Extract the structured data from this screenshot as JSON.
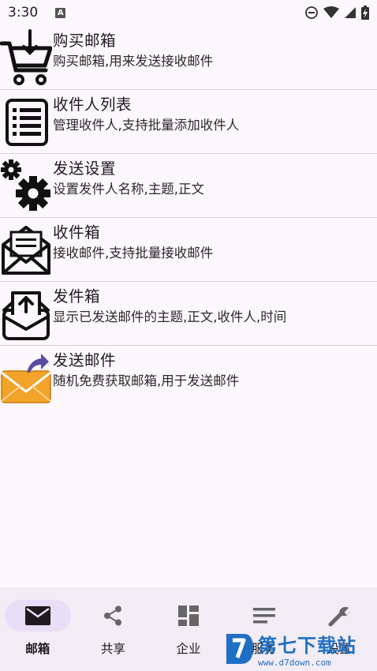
{
  "status_bar": {
    "time": "3:30",
    "badge": "A"
  },
  "list": {
    "items": [
      {
        "title": "购买邮箱",
        "desc": "购买邮箱,用来发送接收邮件",
        "icon": "shopping-cart-icon"
      },
      {
        "title": "收件人列表",
        "desc": "管理收件人,支持批量添加收件人",
        "icon": "list-icon"
      },
      {
        "title": "发送设置",
        "desc": "设置发件人名称,主题,正文",
        "icon": "gears-icon"
      },
      {
        "title": "收件箱",
        "desc": "接收邮件,支持批量接收邮件",
        "icon": "open-envelope-icon"
      },
      {
        "title": "发件箱",
        "desc": "显示已发送邮件的主题,正文,收件人,时间",
        "icon": "outbox-icon"
      },
      {
        "title": "发送邮件",
        "desc": "随机免费获取邮箱,用于发送邮件",
        "icon": "send-mail-icon"
      }
    ]
  },
  "bottom_nav": {
    "items": [
      {
        "label": "邮箱",
        "icon": "mail-icon",
        "active": true
      },
      {
        "label": "共享",
        "icon": "share-icon",
        "active": false
      },
      {
        "label": "企业",
        "icon": "dashboard-icon",
        "active": false
      },
      {
        "label": "服务",
        "icon": "lines-icon",
        "active": false
      },
      {
        "label": "设置",
        "icon": "wrench-icon",
        "active": false
      }
    ]
  },
  "watermark": {
    "name": "第七下载站",
    "url": "www.d7down.com"
  },
  "colors": {
    "background": "#fcf7fc",
    "nav_background": "#f2ecf4",
    "active_pill": "#e8def8",
    "divider": "#d8d4d8",
    "watermark": "#1f6fc4"
  }
}
